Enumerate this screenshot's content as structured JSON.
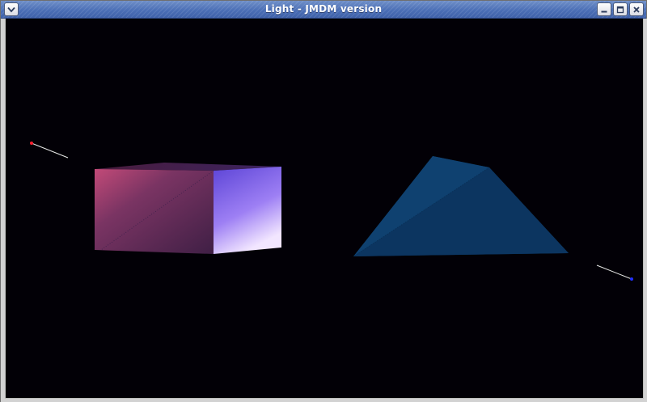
{
  "window": {
    "title": "Light - JMDM version"
  },
  "icons": {
    "menu": "chevron-down-icon",
    "minimize": "minimize-icon",
    "maximize": "maximize-icon",
    "close": "close-icon"
  },
  "colors": {
    "scene_background": "#020006",
    "light_left": "#ff2030",
    "light_right": "#2030ff",
    "cube_front": "#5a2a55",
    "cube_side": "#9a7cf0",
    "pyramid": "#0e3a66"
  }
}
